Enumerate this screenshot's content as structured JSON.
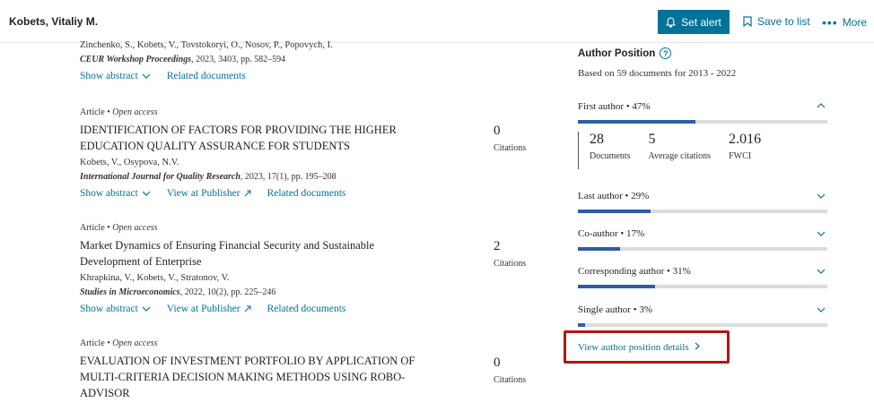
{
  "header": {
    "author_name": "Kobets, Vitaliy M.",
    "set_alert": "Set alert",
    "save_to_list": "Save to list",
    "more": "More"
  },
  "documents": [
    {
      "authors": "Zinchenko, S., Kobets, V., Tovstokoryi, O., Nosov, P., Popovych, I.",
      "source_name": "CEUR Workshop Proceedings",
      "source_rest": ", 2023, 3403, pp. 582–594",
      "show_abstract": "Show abstract",
      "related": "Related documents"
    },
    {
      "type": "Article",
      "access": "Open access",
      "title": "IDENTIFICATION OF FACTORS FOR PROVIDING THE HIGHER EDUCATION QUALITY ASSURANCE FOR STUDENTS",
      "authors": "Kobets, V., Osypova, N.V.",
      "source_name": "International Journal for Quality Research",
      "source_rest": ", 2023, 17(1), pp. 195–208",
      "show_abstract": "Show abstract",
      "view_publisher": "View at Publisher",
      "related": "Related documents",
      "citations": "0",
      "citations_label": "Citations"
    },
    {
      "type": "Article",
      "access": "Open access",
      "title": "Market Dynamics of Ensuring Financial Security and Sustainable Development of Enterprise",
      "authors": "Khrapkina, V., Kobets, V., Stratonov, V.",
      "source_name": "Studies in Microeconomics",
      "source_rest": ", 2022, 10(2), pp. 225–246",
      "show_abstract": "Show abstract",
      "view_publisher": "View at Publisher",
      "related": "Related documents",
      "citations": "2",
      "citations_label": "Citations"
    },
    {
      "type": "Article",
      "access": "Open access",
      "title": "EVALUATION OF INVESTMENT PORTFOLIO BY APPLICATION OF MULTI-CRITERIA DECISION MAKING METHODS USING ROBO-ADVISOR",
      "citations": "0",
      "citations_label": "Citations"
    }
  ],
  "author_position": {
    "title": "Author Position",
    "subtitle": "Based on 59 documents for 2013 - 2022",
    "rows": [
      {
        "label": "First author",
        "percent": "47%",
        "value": 0.47
      },
      {
        "label": "Last author",
        "percent": "29%",
        "value": 0.29
      },
      {
        "label": "Co-author",
        "percent": "17%",
        "value": 0.17
      },
      {
        "label": "Corresponding author",
        "percent": "31%",
        "value": 0.31
      },
      {
        "label": "Single author",
        "percent": "3%",
        "value": 0.03
      }
    ],
    "stats": [
      {
        "value": "28",
        "label": "Documents"
      },
      {
        "value": "5",
        "label": "Average citations"
      },
      {
        "value": "2.016",
        "label": "FWCI"
      }
    ],
    "details_link": "View author position details"
  },
  "colors": {
    "accent": "#007398",
    "bar": "#2c5ea3",
    "highlight": "#b01717"
  }
}
